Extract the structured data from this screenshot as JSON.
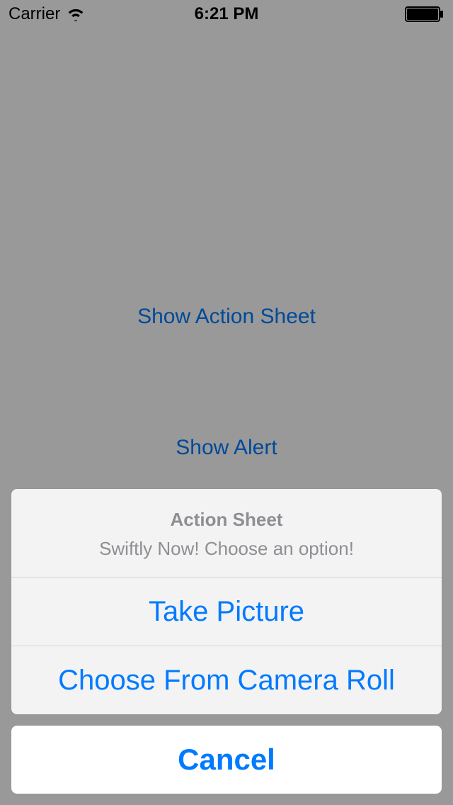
{
  "status_bar": {
    "carrier": "Carrier",
    "time": "6:21 PM"
  },
  "background": {
    "button1": "Show Action Sheet",
    "button2": "Show Alert"
  },
  "action_sheet": {
    "title": "Action Sheet",
    "message": "Swiftly Now! Choose an option!",
    "options": [
      "Take Picture",
      "Choose From Camera Roll"
    ],
    "cancel": "Cancel"
  },
  "colors": {
    "tint": "#007aff",
    "secondary_text": "#8e8e93"
  }
}
